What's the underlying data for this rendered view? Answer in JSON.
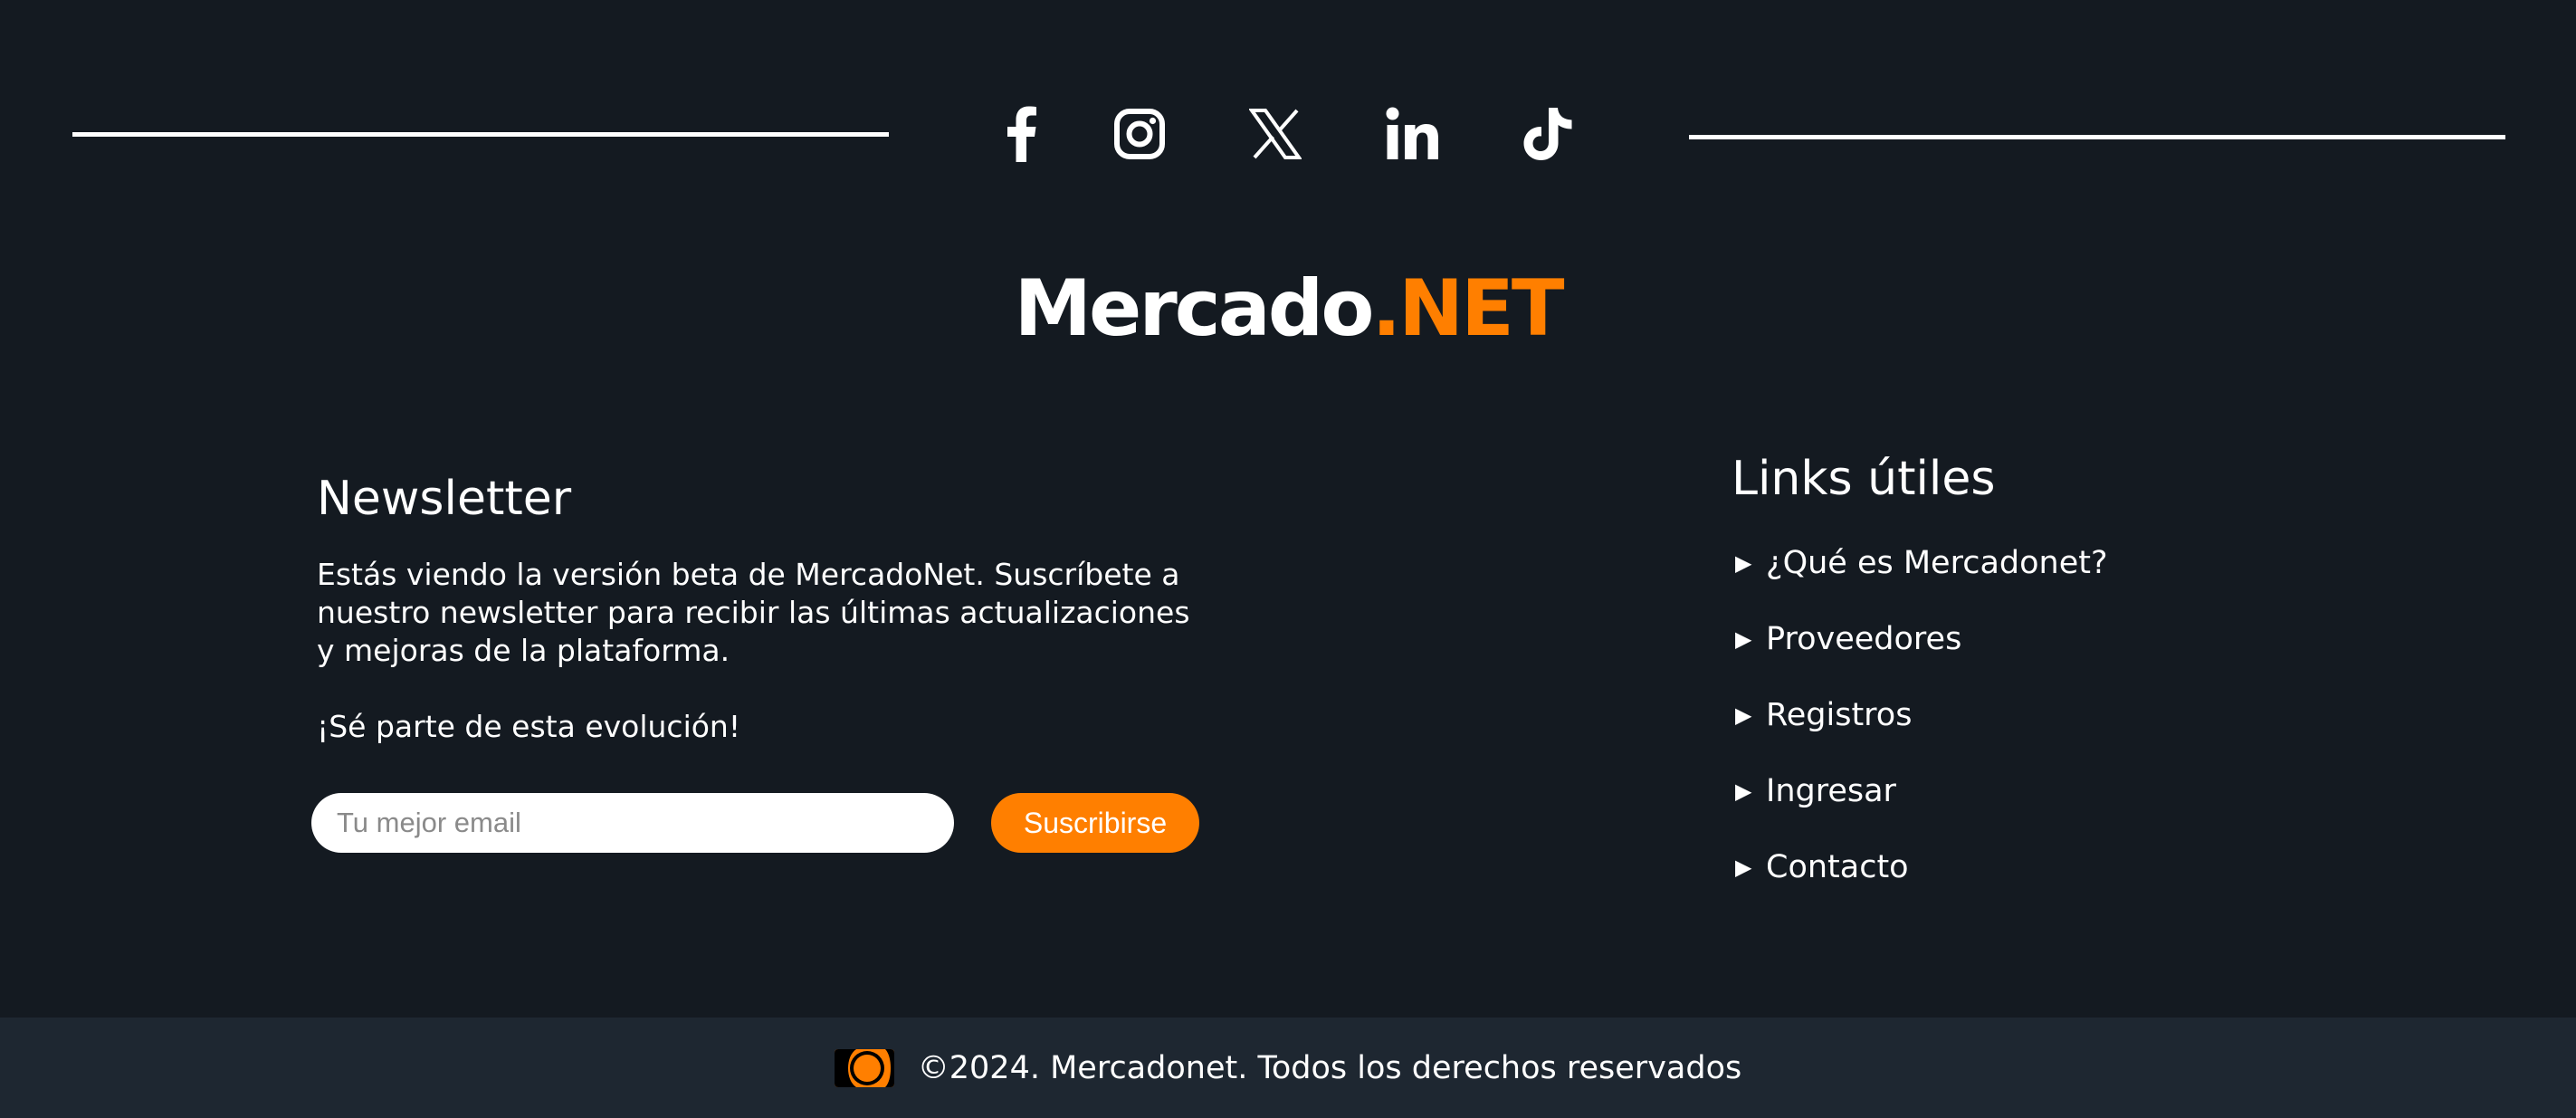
{
  "social": {
    "icons": [
      "facebook-icon",
      "instagram-icon",
      "x-icon",
      "linkedin-icon",
      "tiktok-icon"
    ]
  },
  "brand": {
    "name_main": "Mercado",
    "name_accent": ".NET",
    "accent_color": "#ff7f00"
  },
  "newsletter": {
    "title": "Newsletter",
    "body": "Estás viendo la versión beta de MercadoNet. Suscríbete a nuestro newsletter para recibir las últimas actualiza­ciones y mejoras de la plataforma.",
    "cta": "¡Sé parte de esta evolución!",
    "email_placeholder": "Tu mejor email",
    "email_value": "",
    "subscribe_label": "Suscribirse"
  },
  "links": {
    "title": "Links útiles",
    "items": [
      {
        "label": "¿Qué es Mercadonet?"
      },
      {
        "label": "Proveedores"
      },
      {
        "label": "Registros"
      },
      {
        "label": "Ingresar"
      },
      {
        "label": "Contacto"
      }
    ]
  },
  "footer": {
    "copyright": "©2024. Mercadonet. Todos los derechos reservados"
  },
  "colors": {
    "background": "#141a21",
    "bottom_bar": "#1e2731",
    "accent": "#ff7f00"
  }
}
